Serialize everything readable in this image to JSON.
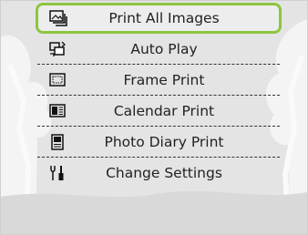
{
  "menu": {
    "items": [
      {
        "label": "Print All Images",
        "icon": "print-all-images-icon",
        "selected": true
      },
      {
        "label": "Auto Play",
        "icon": "auto-play-icon",
        "selected": false
      },
      {
        "label": "Frame Print",
        "icon": "frame-print-icon",
        "selected": false
      },
      {
        "label": "Calendar Print",
        "icon": "calendar-print-icon",
        "selected": false
      },
      {
        "label": "Photo Diary Print",
        "icon": "photo-diary-print-icon",
        "selected": false
      },
      {
        "label": "Change Settings",
        "icon": "change-settings-icon",
        "selected": false
      }
    ]
  },
  "colors": {
    "selection_border": "#8cc63f",
    "background": "#e6e6e6",
    "text": "#222222"
  }
}
